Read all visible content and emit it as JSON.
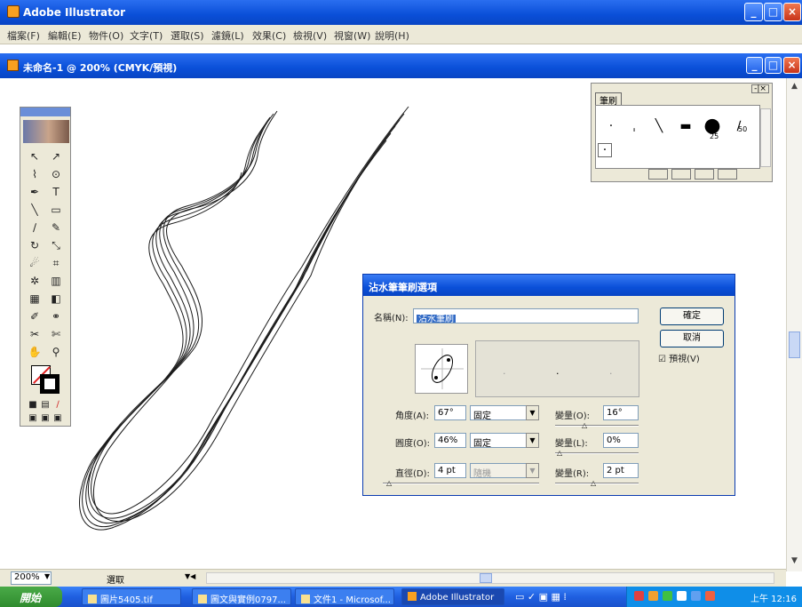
{
  "app": {
    "title": "Adobe Illustrator"
  },
  "menu": [
    "檔案(F)",
    "編輯(E)",
    "物件(O)",
    "文字(T)",
    "選取(S)",
    "濾鏡(L)",
    "效果(C)",
    "檢視(V)",
    "視窗(W)",
    "說明(H)"
  ],
  "document": {
    "title": "未命名-1 @ 200% (CMYK/預視)"
  },
  "brushes_panel": {
    "tab_label": "筆刷",
    "brush_size_1": "25",
    "brush_size_2": "50"
  },
  "dialog": {
    "title": "沾水筆筆刷選項",
    "name_label": "名稱(N):",
    "name_value": "沾水筆刷",
    "ok_label": "確定",
    "cancel_label": "取消",
    "preview_label": "預視(V)",
    "angle_label": "角度(A):",
    "angle_value": "67°",
    "angle_mode": "固定",
    "angle_variation_label": "變量(O):",
    "angle_variation_value": "16°",
    "roundness_label": "圓度(O):",
    "roundness_value": "46%",
    "roundness_mode": "固定",
    "roundness_variation_label": "變量(L):",
    "roundness_variation_value": "0%",
    "diameter_label": "直徑(D):",
    "diameter_value": "4 pt",
    "diameter_mode": "隨機",
    "diameter_variation_label": "變量(R):",
    "diameter_variation_value": "2 pt"
  },
  "status": {
    "zoom": "200%",
    "mode": "選取"
  },
  "taskbar": {
    "start_label": "開始",
    "tasks": [
      "圖片5405.tif",
      "圖文與實例0797...",
      "文件1 - Microsof...",
      "Adobe Illustrator"
    ],
    "clock": "上午 12:16"
  },
  "colors": {
    "xp_blue": "#0a4fd8",
    "start_green": "#2f8c2e",
    "chrome": "#ece9d8"
  }
}
